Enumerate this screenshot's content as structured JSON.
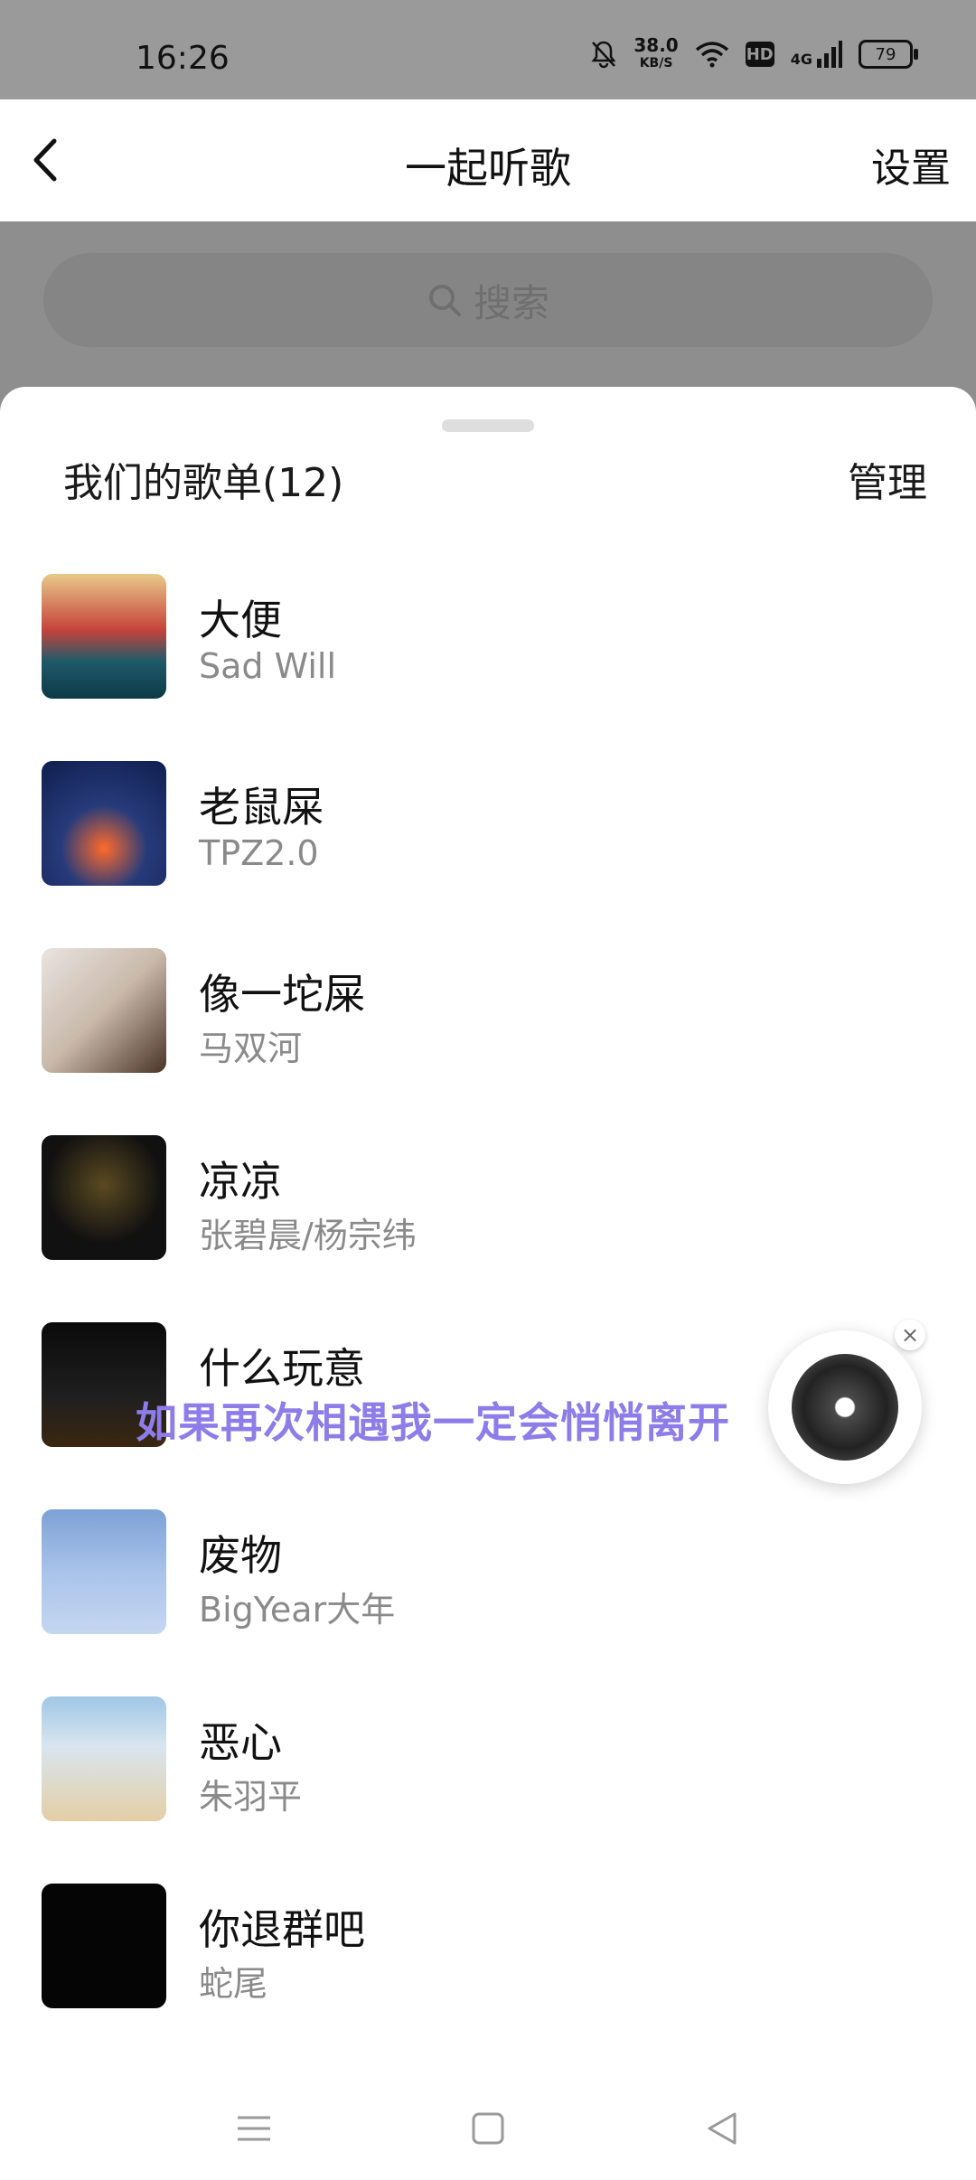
{
  "status_bar": {
    "time": "16:26",
    "net_speed_value": "38.0",
    "net_speed_unit": "KB/S",
    "hd": "HD",
    "signal": "4G",
    "battery": "79"
  },
  "header": {
    "title": "一起听歌",
    "settings_label": "设置"
  },
  "search": {
    "placeholder": "搜索"
  },
  "playlist": {
    "title": "我们的歌单(12)",
    "manage_label": "管理",
    "songs": [
      {
        "title": "大便",
        "artist": "Sad Will"
      },
      {
        "title": "老鼠屎",
        "artist": "TPZ2.0"
      },
      {
        "title": "像一坨屎",
        "artist": "马双河"
      },
      {
        "title": "凉凉",
        "artist": "张碧晨/杨宗纬"
      },
      {
        "title": "什么玩意",
        "artist": ""
      },
      {
        "title": "废物",
        "artist": "BigYear大年"
      },
      {
        "title": "恶心",
        "artist": "朱羽平"
      },
      {
        "title": "你退群吧",
        "artist": "蛇尾"
      }
    ]
  },
  "floating_player": {
    "lyric": "如果再次相遇我一定会悄悄离开"
  },
  "colors": {
    "lyric": "#8e7ce8",
    "artist_text": "#8a8a8a",
    "dim_overlay": "#8e8e8e"
  }
}
